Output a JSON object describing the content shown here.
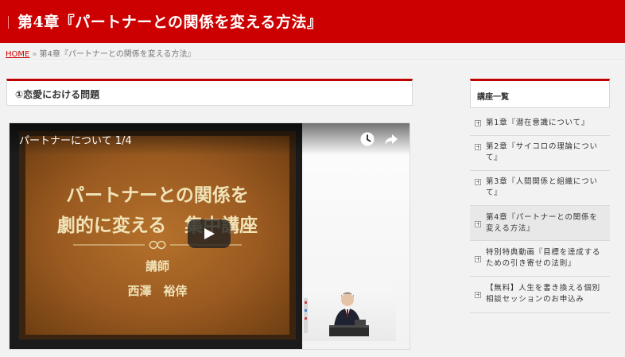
{
  "header": {
    "title": "第4章『パートナーとの関係を変える方法』"
  },
  "breadcrumb": {
    "home": "HOME",
    "separator": "»",
    "current": "第4章『パートナーとの関係を変える方法』"
  },
  "section": {
    "title": "①恋愛における問題"
  },
  "video": {
    "title": "パートナーについて 1/4",
    "board_line1": "パートナーとの関係を",
    "board_line2": "劇的に変える　集中講座",
    "board_role": "講師",
    "board_name": "西澤　裕倖",
    "icons": [
      "clock-icon",
      "share-icon",
      "play-icon"
    ]
  },
  "sidebar": {
    "title": "講座一覧",
    "items": [
      {
        "label": "第1章『潜在意識について』"
      },
      {
        "label": "第2章『サイコロの理論について』"
      },
      {
        "label": "第3章『人間関係と組織について』"
      },
      {
        "label": "第4章『パートナーとの関係を変える方法』",
        "active": true
      },
      {
        "label": "特別特典動画『目標を達成するための引き寄せの法則』"
      },
      {
        "label": "【無料】人生を書き換える個別相談セッションのお申込み"
      }
    ]
  },
  "colors": {
    "brand": "#cc0000",
    "link": "#cc0000",
    "board": "#9a5a20"
  }
}
